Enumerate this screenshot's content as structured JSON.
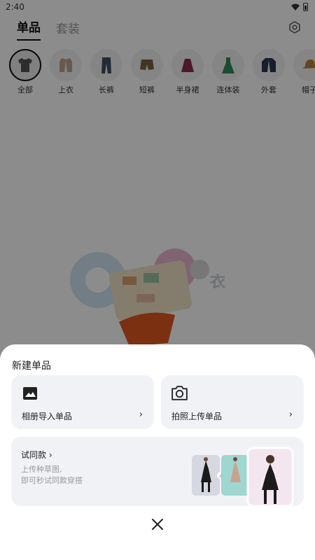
{
  "status": {
    "time": "2:40"
  },
  "tabs": [
    {
      "label": "单品",
      "active": true
    },
    {
      "label": "套装",
      "active": false
    }
  ],
  "categories": [
    {
      "label": "全部",
      "icon": "tshirt-icon",
      "color": "#555555"
    },
    {
      "label": "上衣",
      "icon": "jacket-icon",
      "color": "#bca58a"
    },
    {
      "label": "长裤",
      "icon": "jeans-icon",
      "color": "#3f4f63"
    },
    {
      "label": "短裤",
      "icon": "shorts-icon",
      "color": "#7a6240"
    },
    {
      "label": "半身裙",
      "icon": "skirt-icon",
      "color": "#8a2d4f"
    },
    {
      "label": "连体装",
      "icon": "dress-icon",
      "color": "#2f8a58"
    },
    {
      "label": "外套",
      "icon": "coat-icon",
      "color": "#2a3650"
    },
    {
      "label": "帽子",
      "icon": "hat-icon",
      "color": "#b5803a"
    }
  ],
  "sheet": {
    "title": "新建单品",
    "album_label": "相册导入单品",
    "camera_label": "拍照上传单品",
    "chevron": "›",
    "try": {
      "title": "试同款 ›",
      "sub1": "上传种草图,",
      "sub2": "即可秒试同款穿搭"
    }
  },
  "colors": {
    "overlay": "rgba(0,0,0,0.45)",
    "card_bg": "#f1f2f6"
  }
}
